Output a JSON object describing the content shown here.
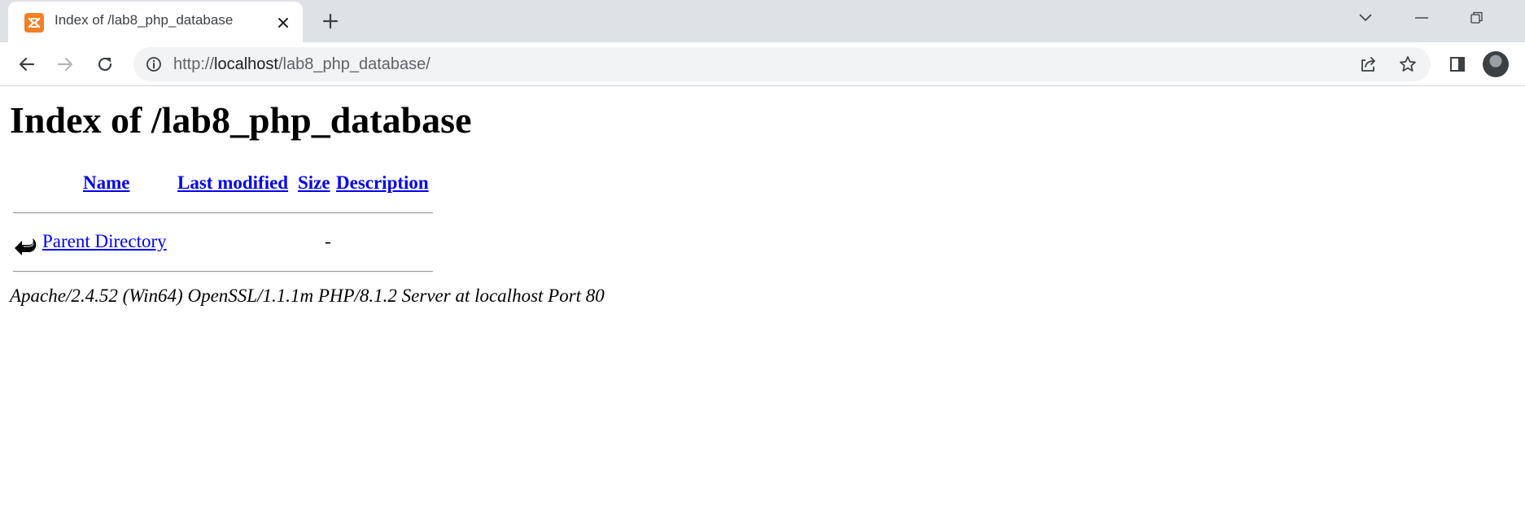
{
  "browser": {
    "tab": {
      "title": "Index of /lab8_php_database",
      "favicon": "xampp-icon"
    },
    "address_bar": {
      "scheme": "http://",
      "host": "localhost",
      "path": "/lab8_php_database/"
    },
    "colors": {
      "tabstrip_bg": "#dee1e6",
      "omnibox_bg": "#f1f3f4",
      "favicon": "#f57f24"
    }
  },
  "page": {
    "title": "Index of /lab8_php_database",
    "table": {
      "columns": [
        "Name",
        "Last modified",
        "Size",
        "Description"
      ],
      "rows": [
        {
          "icon": "back-arrow-icon",
          "name": "Parent Directory",
          "last_modified": "",
          "size": "-",
          "description": ""
        }
      ]
    },
    "server_signature": "Apache/2.4.52 (Win64) OpenSSL/1.1.1m PHP/8.1.2 Server at localhost Port 80",
    "link_color": "#0000ee"
  }
}
